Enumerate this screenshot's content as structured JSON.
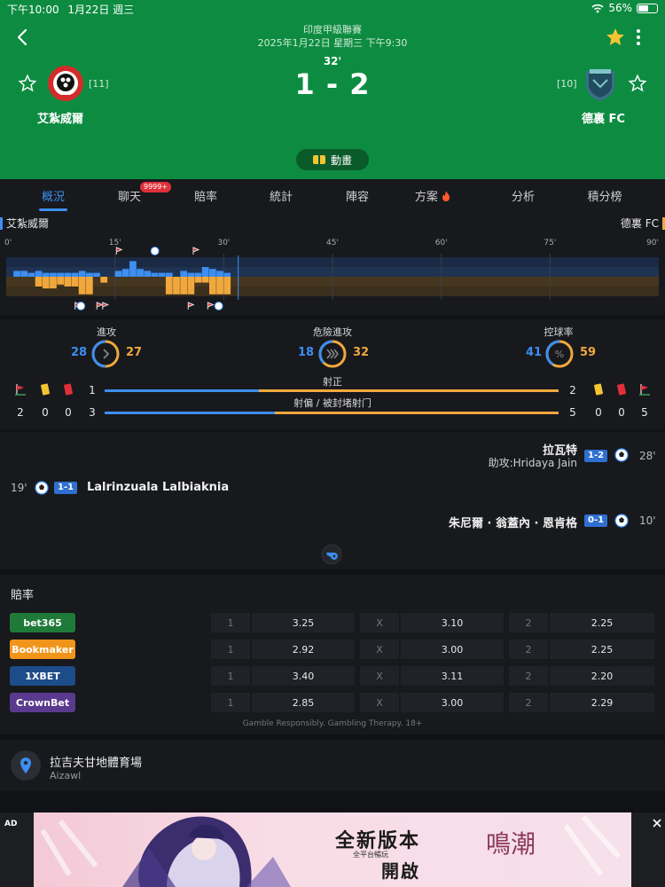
{
  "status_bar": {
    "time": "下午10:00",
    "date": "1月22日 週三",
    "battery": "56%",
    "battery_level": 0.56
  },
  "header": {
    "league": "印度甲級聯賽",
    "date": "2025年1月22日 星期三 下午9:30",
    "minute": "32'",
    "score": "1 - 2",
    "animation_label": "動畫",
    "home": {
      "name": "艾紮威爾",
      "rank": "[11]"
    },
    "away": {
      "name": "德裏 FC",
      "rank": "[10]"
    },
    "colors": {
      "bg": "#0d8c41",
      "star": "#f4c531"
    }
  },
  "tabs": [
    {
      "label": "概況",
      "active": true
    },
    {
      "label": "聊天"
    },
    {
      "label": "賠率"
    },
    {
      "label": "統計"
    },
    {
      "label": "陣容"
    },
    {
      "label": "方案"
    },
    {
      "label": "分析"
    },
    {
      "label": "積分榜"
    }
  ],
  "chat_badge": "9999+",
  "timeline": {
    "home": "艾紮威爾",
    "away": "德裏 FC",
    "ticks": [
      "0'",
      "15'",
      "30'",
      "45'",
      "60'",
      "75'",
      "90'"
    ],
    "current_minute": 32,
    "home_pressure": [
      0,
      3,
      3,
      2,
      3,
      2,
      2,
      2,
      2,
      2,
      3,
      2,
      2,
      0,
      0,
      3,
      4,
      8,
      4,
      3,
      2,
      2,
      2,
      0,
      3,
      2,
      2,
      5,
      4,
      3,
      2,
      0
    ],
    "away_pressure": [
      0,
      0,
      0,
      0,
      5,
      6,
      6,
      4,
      5,
      5,
      9,
      9,
      0,
      3,
      0,
      0,
      0,
      0,
      0,
      0,
      0,
      0,
      9,
      9,
      9,
      9,
      3,
      3,
      9,
      9,
      9,
      0
    ],
    "home_events": [
      16,
      29
    ],
    "away_events": [
      10,
      27,
      31
    ],
    "colors": {
      "home": "#3d8ef0",
      "away": "#f0a83d"
    }
  },
  "stats": {
    "attacks": {
      "label": "進攻",
      "home": "28",
      "away": "27"
    },
    "dangerous_attacks": {
      "label": "危險進攻",
      "home": "18",
      "away": "32"
    },
    "possession": {
      "label": "控球率",
      "home": "41",
      "away": "59"
    },
    "on_target": {
      "label": "射正",
      "home": "1",
      "away": "2",
      "home_share": 0.34
    },
    "off_target": {
      "label": "射偏 / 被封堵射门",
      "home": "3",
      "away": "5",
      "home_share": 0.375
    },
    "home_corners": "2",
    "home_yellow": "0",
    "home_red": "0",
    "away_yellow": "0",
    "away_red": "0",
    "away_corners": "5"
  },
  "events": [
    {
      "side": "away",
      "player": "拉瓦特",
      "assist": "助攻:Hridaya Jain",
      "score": "1-2",
      "minute": "28'"
    },
    {
      "side": "home",
      "player": "Lalrinzuala Lalbiaknia",
      "score": "1-1",
      "minute": "19'"
    },
    {
      "side": "away",
      "player": "朱尼爾 · 翁蓋內 · 恩肯格",
      "score": "0-1",
      "minute": "10'"
    }
  ],
  "odds": {
    "title": "賠率",
    "disclaimer": "Gamble Responsibly. Gambling Therapy. 18+",
    "rows": [
      {
        "bookmaker": "bet365",
        "color": "#1f7a3a",
        "l1": "1",
        "v1": "3.25",
        "lx": "X",
        "vx": "3.10",
        "l2": "2",
        "v2": "2.25"
      },
      {
        "bookmaker": "Bookmaker",
        "color": "#f0951a",
        "l1": "1",
        "v1": "2.92",
        "lx": "X",
        "vx": "3.00",
        "l2": "2",
        "v2": "2.25"
      },
      {
        "bookmaker": "1XBET",
        "color": "#1d4c8a",
        "l1": "1",
        "v1": "3.40",
        "lx": "X",
        "vx": "3.11",
        "l2": "2",
        "v2": "2.20"
      },
      {
        "bookmaker": "CrownBet",
        "color": "#5a3a8e",
        "l1": "1",
        "v1": "2.85",
        "lx": "X",
        "vx": "3.00",
        "l2": "2",
        "v2": "2.29"
      }
    ]
  },
  "venue": {
    "name": "拉吉夫甘地體育場",
    "city": "Aizawl"
  },
  "ad": {
    "tag": "AD",
    "headline": "全新版本",
    "headline2": "開啟",
    "sub": "全平台暢玩",
    "brand": "鳴潮"
  }
}
